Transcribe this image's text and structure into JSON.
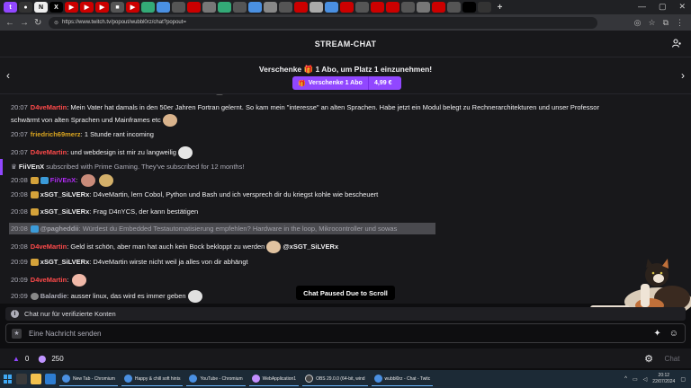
{
  "browser": {
    "url": "https://www.twitch.tv/popout/wubbl0rz/chat?popout=",
    "tabs": [
      {
        "icon": "twitch-icon",
        "color": "#9147ff",
        "text": "t"
      },
      {
        "icon": "github-icon",
        "color": "#333",
        "text": "●"
      },
      {
        "icon": "notion-icon",
        "color": "#fff",
        "text": "N"
      },
      {
        "icon": "x-icon",
        "color": "#000",
        "text": "X"
      },
      {
        "icon": "video-icon",
        "color": "#c00",
        "text": "▶"
      },
      {
        "icon": "video-icon",
        "color": "#c00",
        "text": "▶"
      },
      {
        "icon": "video-icon",
        "color": "#c00",
        "text": "▶"
      },
      {
        "icon": "bookmark-icon",
        "color": "#555",
        "text": "■"
      },
      {
        "icon": "video-icon",
        "color": "#c00",
        "text": "▶"
      }
    ]
  },
  "header": {
    "title": "STREAM-CHAT"
  },
  "gift": {
    "text_before": "Verschenke",
    "count": "1",
    "text_after": "Abo, um Platz 1 einzunehmen!",
    "button_label": "Verschenke 1 Abo",
    "price": "4,99 €"
  },
  "messages": [
    {
      "ts": "20:07",
      "user": "D4veMartin",
      "color": "#ff4a4a",
      "text": "Mein Vater hat damals in den 50er Jahren Fortran gelernt. So kam mein \"interesse\" an alten Sprachen. Habe jetzt ein Modul belegt zu Rechnerarchitekturen und unser Professor",
      "text2": "schwärmt von alten Sprachen und Mainframes etc"
    },
    {
      "ts": "20:07",
      "user": "friedrich69merz",
      "color": "#daa520",
      "text": "1 Stunde rant incoming"
    },
    {
      "ts": "20:07",
      "user": "D4veMartin",
      "color": "#ff4a4a",
      "text": "und webdesign ist mir zu langweilig"
    },
    {
      "ts": "",
      "user": "FiiVEnX",
      "color": "#efeff1",
      "text": "subscribed with Prime Gaming. They've subscribed for 12 months!"
    },
    {
      "ts": "20:08",
      "user": "FiiVEnX",
      "color": "#b12bf5",
      "text": ""
    },
    {
      "ts": "20:08",
      "user": "xSGT_SiLVERx",
      "color": "#efeff1",
      "text": "D4veMartin, lern Cobol, Python und Bash und ich versprech dir du kriegst kohle wie bescheuert"
    },
    {
      "ts": "20:08",
      "user": "xSGT_SiLVERx",
      "color": "#efeff1",
      "text": "Frag D4nYCS, der kann bestätigen"
    },
    {
      "ts": "20:08",
      "user": "@pagheddii",
      "color": "#adadb8",
      "text": "Würdest du Embedded Testautomatisierung empfehlen? Hardware in the loop, Mikrocontroller und sowas"
    },
    {
      "ts": "20:08",
      "user": "D4veMartin",
      "color": "#ff4a4a",
      "text": "Geld ist schön, aber man hat auch kein Bock bekloppt zu werden",
      "mention": "@xSGT_SiLVERx"
    },
    {
      "ts": "20:09",
      "user": "xSGT_SiLVERx",
      "color": "#efeff1",
      "text": "D4veMartin wirste nicht weil ja alles von dir abhängt"
    },
    {
      "ts": "20:09",
      "user": "D4veMartin",
      "color": "#ff4a4a",
      "text": ""
    },
    {
      "ts": "20:09",
      "user": "Balardie",
      "color": "#adadb8",
      "text": "ausser linux, das wird es immer geben"
    }
  ],
  "paused_label": "Chat Paused Due to Scroll",
  "notice": "Chat nur für verifizierte Konten",
  "input": {
    "placeholder": "Eine Nachricht senden"
  },
  "footer": {
    "bits": "0",
    "points": "250",
    "chat_button": "Chat"
  },
  "taskbar": {
    "apps": [
      {
        "label": "New Tab - Chromium",
        "color": "#4a90e2"
      },
      {
        "label": "Happy & chill soft hints",
        "color": "#4a90e2"
      },
      {
        "label": "YouTube - Chromium",
        "color": "#4a90e2"
      },
      {
        "label": "WebApplication1",
        "color": "#c38fff"
      },
      {
        "label": "OBS 29.0.0 (64-bit, wind",
        "color": "#444"
      },
      {
        "label": "wubbl0rz - Chat - Twitc",
        "color": "#4a90e2"
      }
    ],
    "time": "20:12",
    "date": "22/07/2024"
  }
}
